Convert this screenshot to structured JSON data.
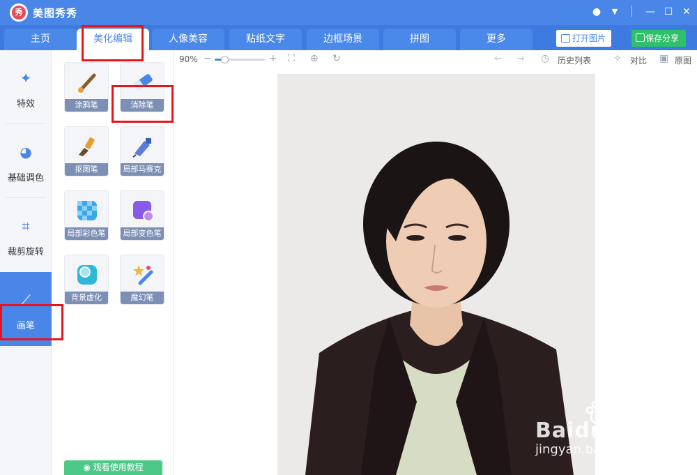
{
  "app": {
    "title": "美图秀秀",
    "logo_char": "秀"
  },
  "nav": {
    "tabs": [
      {
        "label": "主页"
      },
      {
        "label": "美化编辑"
      },
      {
        "label": "人像美容"
      },
      {
        "label": "贴纸文字"
      },
      {
        "label": "边框场景"
      },
      {
        "label": "拼图"
      },
      {
        "label": "更多"
      }
    ],
    "active_index": 1,
    "open_image": "打开图片",
    "save_share": "保存分享"
  },
  "leftnav": {
    "items": [
      {
        "label": "特效",
        "icon": "magic-wand-icon"
      },
      {
        "label": "基础调色",
        "icon": "palette-icon"
      },
      {
        "label": "裁剪旋转",
        "icon": "crop-icon"
      },
      {
        "label": "画笔",
        "icon": "brush-icon"
      }
    ],
    "active_index": 3
  },
  "tools": [
    {
      "label": "涂鸦笔",
      "icon": "paint-brush-icon",
      "color": "#e8a23a"
    },
    {
      "label": "消除笔",
      "icon": "eraser-pen-icon",
      "color": "#4a86e8"
    },
    {
      "label": "抠图笔",
      "icon": "cutout-brush-icon",
      "color": "#e89b2e"
    },
    {
      "label": "局部马赛克",
      "icon": "mosaic-pen-icon",
      "color": "#5b7fd6"
    },
    {
      "label": "局部彩色笔",
      "icon": "color-pen-icon",
      "color": "#3aa7e8"
    },
    {
      "label": "局部变色笔",
      "icon": "recolor-pen-icon",
      "color": "#8a5ae8"
    },
    {
      "label": "背景虚化",
      "icon": "blur-bg-icon",
      "color": "#2fb8d8"
    },
    {
      "label": "魔幻笔",
      "icon": "magic-pen-icon",
      "color": "#e8a23a"
    }
  ],
  "tutorial": "观看使用教程",
  "toolbar": {
    "zoom": "90%",
    "zoom_fraction": 0.2,
    "history": "历史列表",
    "compare": "对比",
    "original": "原图"
  },
  "watermark": {
    "brand": "Baidu经验",
    "url": "jingyan.baidu.com"
  },
  "colors": {
    "primary": "#4a86e8",
    "save": "#2fc06b",
    "highlight": "#e8141c"
  }
}
